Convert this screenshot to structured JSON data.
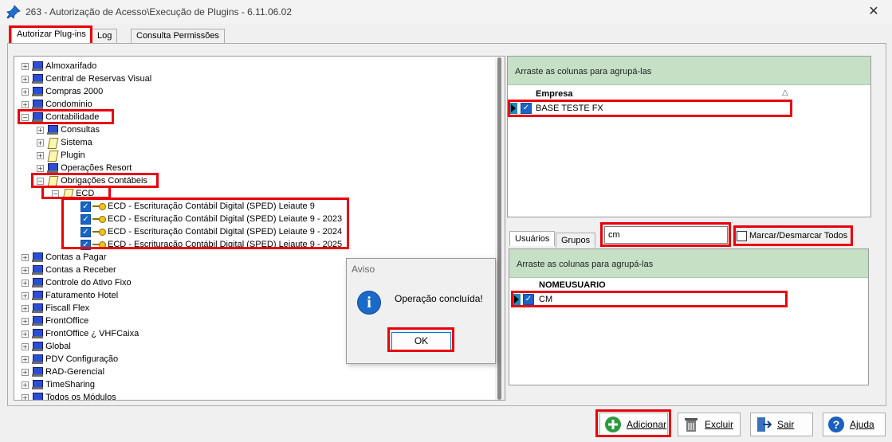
{
  "window": {
    "title": "263 - Autorização de Acesso\\Execução de Plugins - 6.11.06.02",
    "close_glyph": "✕"
  },
  "tabs": [
    "Autorizar Plug-ins",
    "Log",
    "Consulta Permissões"
  ],
  "tree": {
    "items": [
      {
        "label": "Almoxarifado",
        "icon": "computer-icon",
        "expander": "+"
      },
      {
        "label": "Central de Reservas Visual",
        "icon": "computer-icon",
        "expander": "+"
      },
      {
        "label": "Compras 2000",
        "icon": "computer-icon",
        "expander": "+"
      },
      {
        "label": "Condominio",
        "icon": "computer-icon",
        "expander": "+"
      },
      {
        "label": "Contabilidade",
        "icon": "computer-icon",
        "expander": "−"
      },
      {
        "label": "Consultas",
        "icon": "computer-icon",
        "expander": "+"
      },
      {
        "label": "Sistema",
        "icon": "document-icon",
        "expander": "+"
      },
      {
        "label": "Plugin",
        "icon": "document-icon",
        "expander": "+"
      },
      {
        "label": "Operações Resort",
        "icon": "computer-icon",
        "expander": "+"
      },
      {
        "label": "Obrigações Contábeis",
        "icon": "document-icon",
        "expander": "−"
      },
      {
        "label": "ECD",
        "icon": "document-icon",
        "expander": "−"
      },
      {
        "label": "ECD - Escrituração Contábil Digital (SPED)  Leiaute 9",
        "icon": "key-icon",
        "checked": true
      },
      {
        "label": "ECD - Escrituração Contábil Digital (SPED) Leiaute 9 - 2023",
        "icon": "key-icon",
        "checked": true
      },
      {
        "label": "ECD - Escrituração Contábil Digital (SPED) Leiaute 9 - 2024",
        "icon": "key-icon",
        "checked": true
      },
      {
        "label": "ECD - Escrituração Contábil Digital (SPED) Leiaute 9 - 2025",
        "icon": "key-icon",
        "checked": true
      },
      {
        "label": "Contas a Pagar",
        "icon": "computer-icon",
        "expander": "+"
      },
      {
        "label": "Contas a Receber",
        "icon": "computer-icon",
        "expander": "+"
      },
      {
        "label": "Controle do Ativo Fixo",
        "icon": "computer-icon",
        "expander": "+"
      },
      {
        "label": "Faturamento Hotel",
        "icon": "computer-icon",
        "expander": "+"
      },
      {
        "label": "Fiscall Flex",
        "icon": "computer-icon",
        "expander": "+"
      },
      {
        "label": "FrontOffice",
        "icon": "computer-icon",
        "expander": "+"
      },
      {
        "label": "FrontOffice ¿ VHFCaixa",
        "icon": "computer-icon",
        "expander": "+"
      },
      {
        "label": "Global",
        "icon": "computer-icon",
        "expander": "+"
      },
      {
        "label": "PDV Configuração",
        "icon": "computer-icon",
        "expander": "+"
      },
      {
        "label": "RAD-Gerencial",
        "icon": "computer-icon",
        "expander": "+"
      },
      {
        "label": "TimeSharing",
        "icon": "computer-icon",
        "expander": "+"
      },
      {
        "label": "Todos os Módulos",
        "icon": "computer-icon",
        "expander": "+"
      }
    ]
  },
  "empresa_grid": {
    "group_hint": "Arraste as colunas para agrupá-las",
    "column": "Empresa",
    "sort_glyph": "△",
    "rows": [
      "BASE TESTE FX"
    ]
  },
  "sub_tabs": [
    "Usuários",
    "Grupos"
  ],
  "search": {
    "value": "cm"
  },
  "toggle_all": {
    "label": "Marcar/Desmarcar Todos"
  },
  "usuarios_grid": {
    "group_hint": "Arraste as colunas para agrupá-las",
    "column": "NOMEUSUARIO",
    "rows": [
      "CM"
    ]
  },
  "buttons": {
    "adicionar": "Adicionar",
    "excluir": "Excluir",
    "sair": "Sair",
    "ajuda": "Ajuda"
  },
  "dialog": {
    "title": "Aviso",
    "message": "Operação concluída!",
    "ok": "OK",
    "icon_glyph": "i"
  },
  "colors": {
    "highlight": "#e8000b",
    "group_header": "#c6e0c6",
    "check": "#1864c8"
  }
}
